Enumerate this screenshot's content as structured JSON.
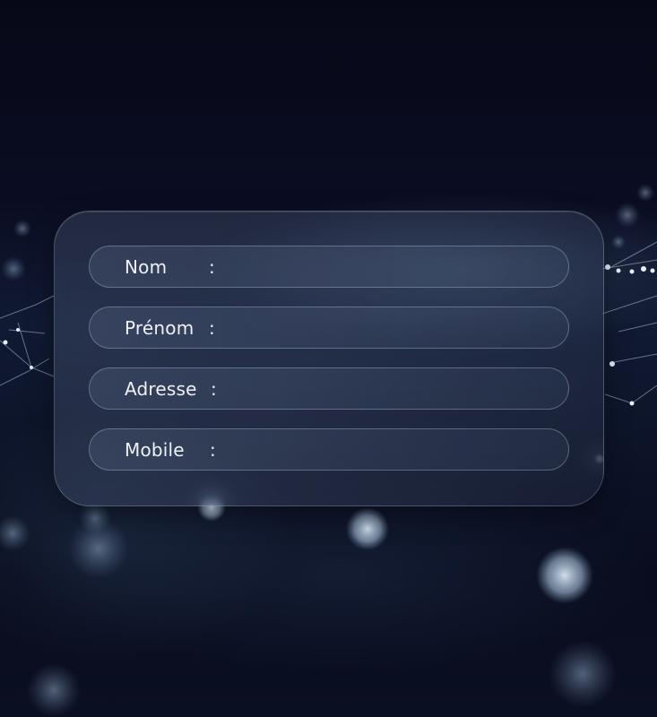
{
  "form": {
    "fields": [
      {
        "label": "Nom",
        "separator": ":"
      },
      {
        "label": "Prénom",
        "separator": ":"
      },
      {
        "label": "Adresse",
        "separator": ":"
      },
      {
        "label": "Mobile",
        "separator": ":"
      }
    ]
  },
  "colors": {
    "background": "#080a1c",
    "text": "#eef2f8",
    "glass_border": "#c8d7eb"
  }
}
